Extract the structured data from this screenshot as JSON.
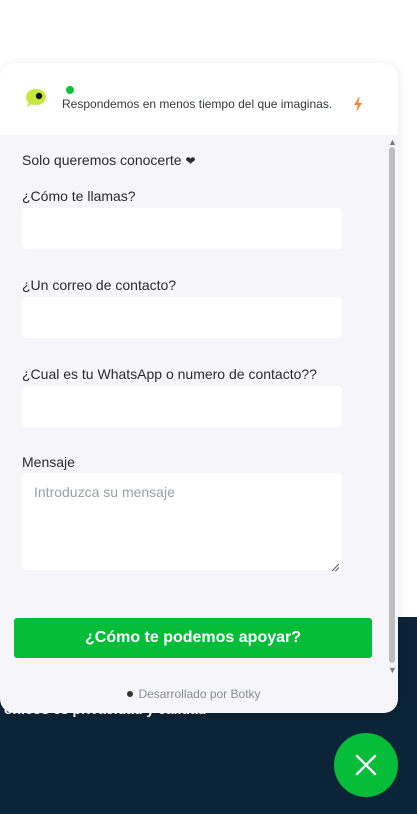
{
  "widget": {
    "tagline": "Respondemos en menos tiempo del que imaginas.",
    "intro": "Solo queremos conocerte",
    "heart": "❤",
    "fields": [
      {
        "label": "¿Cómo te llamas?",
        "value": "",
        "placeholder": ""
      },
      {
        "label": "¿Un correo de contacto?",
        "value": "",
        "placeholder": ""
      },
      {
        "label": "¿Cual es tu WhatsApp o numero de contacto??",
        "value": "",
        "placeholder": ""
      }
    ],
    "message": {
      "label": "Mensaje",
      "placeholder": "Introduzca su mensaje"
    },
    "submit_label": "¿Cómo te podemos apoyar?",
    "powered_by": "Desarrollado por Botky"
  },
  "background": {
    "partial_text": "ónicos es privacidad y calidad"
  },
  "icons": {
    "logo": "chat-bubble-logo-icon",
    "status": "online-dot-icon",
    "bolt": "lightning-bolt-icon",
    "close": "close-icon"
  },
  "colors": {
    "brand_green": "#06bd39",
    "footer_navy": "#0c2437",
    "bolt_orange": "#f5893a",
    "logo_yellow": "#c6e83c"
  }
}
